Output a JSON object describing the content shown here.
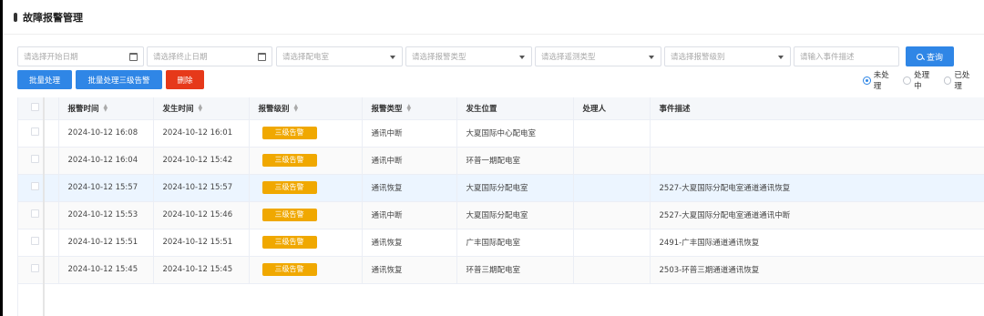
{
  "header": {
    "title": "故障报警管理"
  },
  "filters": {
    "start_date": "请选择开始日期",
    "end_date": "请选择终止日期",
    "room": "请选择配电室",
    "alarm_type": "请选择报警类型",
    "remote_type": "请选择遥测类型",
    "alarm_level": "请选择报警级别",
    "event_desc": "请输入事件描述",
    "query": "查询"
  },
  "actions": {
    "batch": "批量处理",
    "batch_level3": "批量处理三级告警",
    "delete": "删除"
  },
  "status_filter": {
    "options": [
      "未处理",
      "处理中",
      "已处理"
    ],
    "selected": "未处理"
  },
  "table": {
    "columns": [
      "报警时间",
      "发生时间",
      "报警级别",
      "报警类型",
      "发生位置",
      "处理人",
      "事件描述"
    ],
    "rows": [
      {
        "alarm_time": "2024-10-12 16:08",
        "occur_time": "2024-10-12 16:01",
        "level": "三级告警",
        "type": "通讯中断",
        "location": "大夏国际中心配电室",
        "handler": "",
        "desc": ""
      },
      {
        "alarm_time": "2024-10-12 16:04",
        "occur_time": "2024-10-12 15:42",
        "level": "三级告警",
        "type": "通讯中断",
        "location": "环普一期配电室",
        "handler": "",
        "desc": ""
      },
      {
        "alarm_time": "2024-10-12 15:57",
        "occur_time": "2024-10-12 15:57",
        "level": "三级告警",
        "type": "通讯恢复",
        "location": "大夏国际分配电室",
        "handler": "",
        "desc": "2527-大夏国际分配电室通道通讯恢复"
      },
      {
        "alarm_time": "2024-10-12 15:53",
        "occur_time": "2024-10-12 15:46",
        "level": "三级告警",
        "type": "通讯中断",
        "location": "大夏国际分配电室",
        "handler": "",
        "desc": "2527-大夏国际分配电室通道通讯中断"
      },
      {
        "alarm_time": "2024-10-12 15:51",
        "occur_time": "2024-10-12 15:51",
        "level": "三级告警",
        "type": "通讯恢复",
        "location": "广丰国际配电室",
        "handler": "",
        "desc": "2491-广丰国际通道通讯恢复"
      },
      {
        "alarm_time": "2024-10-12 15:45",
        "occur_time": "2024-10-12 15:45",
        "level": "三级告警",
        "type": "通讯恢复",
        "location": "环普三期配电室",
        "handler": "",
        "desc": "2503-环普三期通道通讯恢复"
      }
    ]
  },
  "colors": {
    "primary": "#2f86e6",
    "danger": "#e6391a",
    "warning": "#f0a800"
  }
}
